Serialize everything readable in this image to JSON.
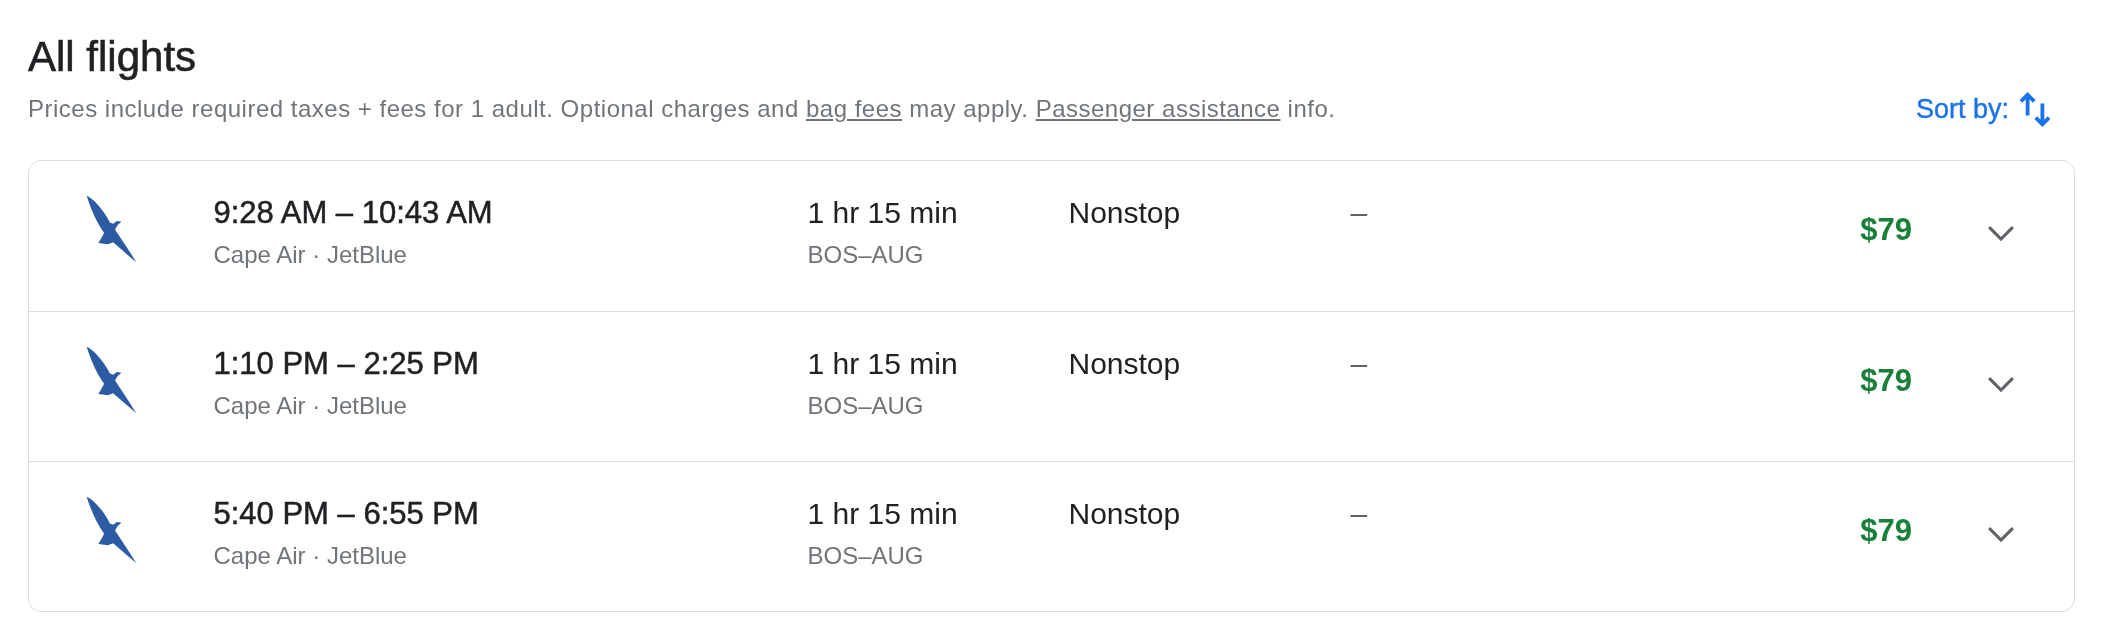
{
  "title": "All flights",
  "notice": [
    {
      "kind": "text",
      "text": "Prices include required taxes + fees for 1 adult. Optional charges and "
    },
    {
      "kind": "link",
      "text": "bag fees"
    },
    {
      "kind": "text",
      "text": " may apply. "
    },
    {
      "kind": "link",
      "text": "Passenger assistance"
    },
    {
      "kind": "text",
      "text": " info."
    }
  ],
  "sort": {
    "label": "Sort by:"
  },
  "flights": [
    {
      "times": "9:28 AM – 10:43 AM",
      "airlines": "Cape Air · JetBlue",
      "duration": "1 hr 15 min",
      "route": "BOS–AUG",
      "stops": "Nonstop",
      "column_5": "–",
      "price": "$79",
      "expanded": false
    },
    {
      "times": "1:10 PM – 2:25 PM",
      "airlines": "Cape Air · JetBlue",
      "duration": "1 hr 15 min",
      "route": "BOS–AUG",
      "stops": "Nonstop",
      "column_5": "–",
      "price": "$79",
      "expanded": false
    },
    {
      "times": "5:40 PM – 6:55 PM",
      "airlines": "Cape Air · JetBlue",
      "duration": "1 hr 15 min",
      "route": "BOS–AUG",
      "stops": "Nonstop",
      "column_5": "–",
      "price": "$79",
      "expanded": false
    }
  ]
}
